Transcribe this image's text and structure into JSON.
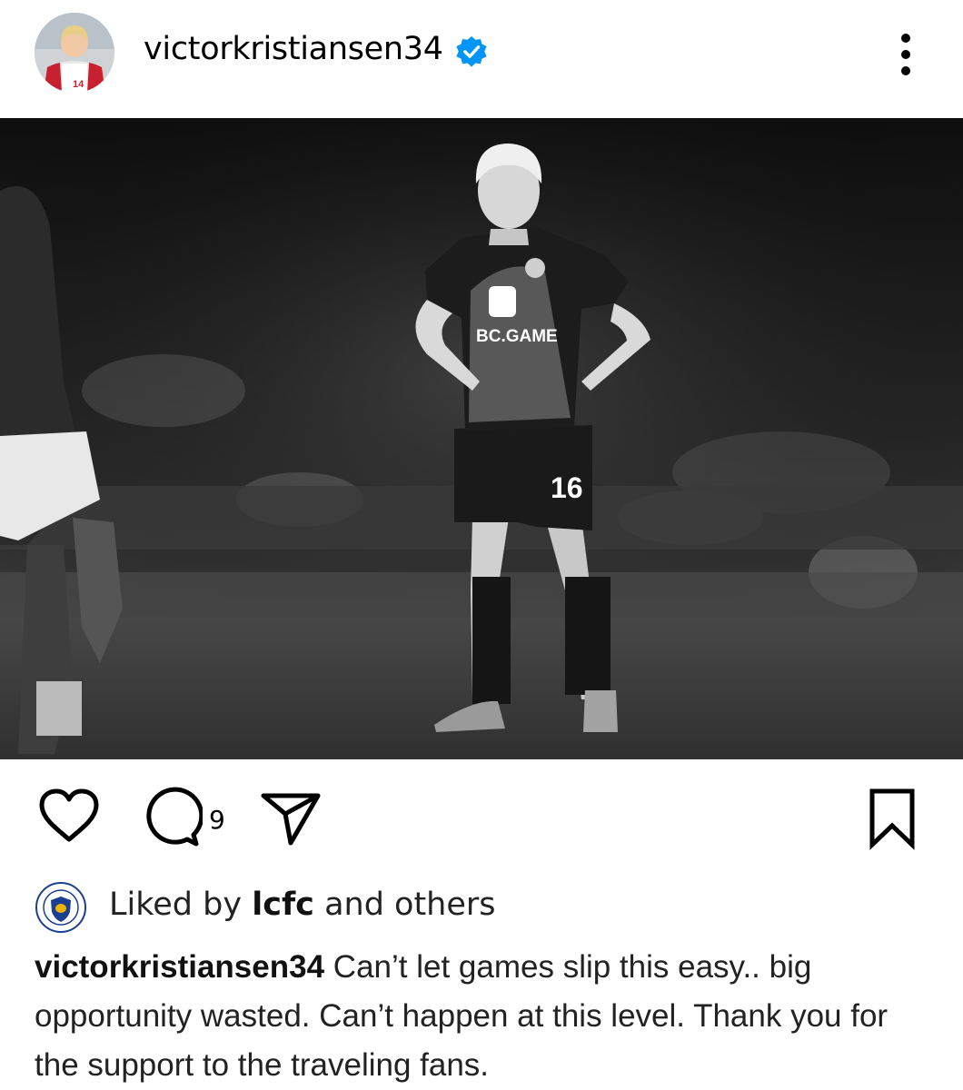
{
  "post": {
    "username": "victorkristiansen34",
    "avatar_jersey_number": "14",
    "verified": true,
    "menu_icon": "more-vertical-icon",
    "photo": {
      "shirt_sponsor": "BC.GAME",
      "shorts_number": "16"
    },
    "actions": {
      "like_icon": "heart-icon",
      "comment_icon": "comment-icon",
      "comment_count": "9",
      "share_icon": "send-icon",
      "save_icon": "bookmark-icon"
    },
    "likes": {
      "prefix": "Liked by",
      "account": "lcfc",
      "suffix": "and others",
      "badge_icon": "lcfc-crest-icon"
    },
    "caption": {
      "username": "victorkristiansen34",
      "text": "Can’t let games slip this easy.. big opportunity wasted. Can’t happen at this level. Thank you for the support to the traveling fans."
    }
  },
  "colors": {
    "verified_blue": "#0095f6",
    "text": "#111111",
    "background": "#ffffff"
  }
}
